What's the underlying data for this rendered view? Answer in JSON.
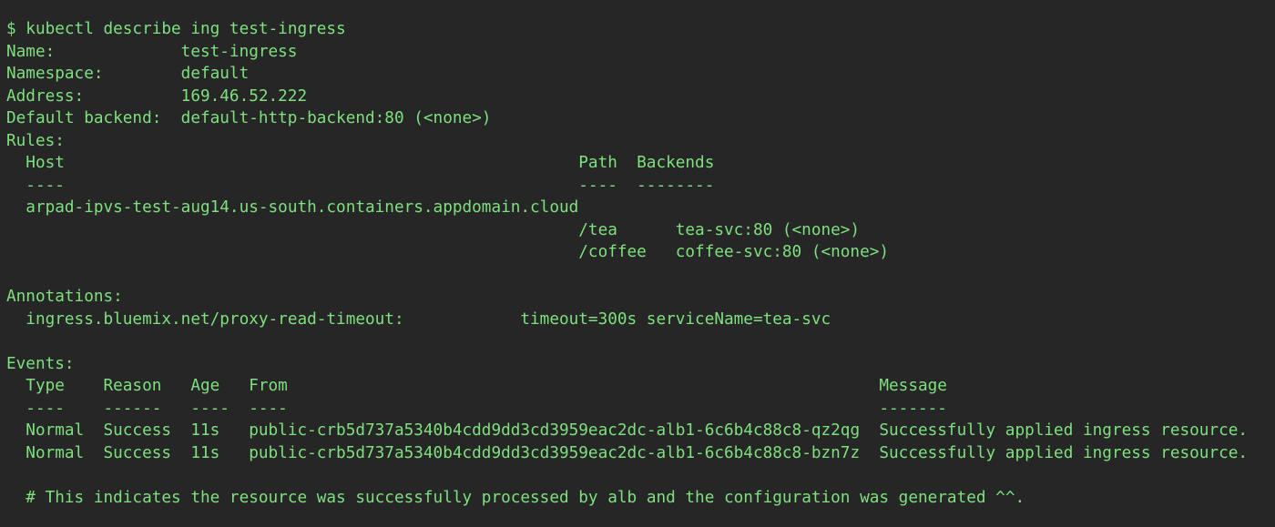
{
  "command": "$ kubectl describe ing test-ingress",
  "fields": {
    "name_label": "Name:",
    "name": "test-ingress",
    "namespace_label": "Namespace:",
    "namespace": "default",
    "address_label": "Address:",
    "address": "169.46.52.222",
    "backend_label": "Default backend:",
    "backend": "default-http-backend:80 (<none>)"
  },
  "rules": {
    "label": "Rules:",
    "headers": {
      "host": "Host",
      "path": "Path",
      "backends": "Backends"
    },
    "dashes": {
      "host": "----",
      "path": "----",
      "backends": "--------"
    },
    "host": "arpad-ipvs-test-aug14.us-south.containers.appdomain.cloud",
    "paths": [
      {
        "path": "/tea",
        "backend": "tea-svc:80 (<none>)"
      },
      {
        "path": "/coffee",
        "backend": "coffee-svc:80 (<none>)"
      }
    ]
  },
  "annotations": {
    "label": "Annotations:",
    "key": "ingress.bluemix.net/proxy-read-timeout:",
    "value": "timeout=300s serviceName=tea-svc"
  },
  "events": {
    "label": "Events:",
    "headers": {
      "type": "Type",
      "reason": "Reason",
      "age": "Age",
      "from": "From",
      "message": "Message"
    },
    "dashes": {
      "type": "----",
      "reason": "------",
      "age": "----",
      "from": "----",
      "message": "-------"
    },
    "rows": [
      {
        "type": "Normal",
        "reason": "Success",
        "age": "11s",
        "from": "public-crb5d737a5340b4cdd9dd3cd3959eac2dc-alb1-6c6b4c88c8-qz2qg",
        "message": "Successfully applied ingress resource."
      },
      {
        "type": "Normal",
        "reason": "Success",
        "age": "11s",
        "from": "public-crb5d737a5340b4cdd9dd3cd3959eac2dc-alb1-6c6b4c88c8-bzn7z",
        "message": "Successfully applied ingress resource."
      }
    ]
  },
  "comment": "# This indicates the resource was successfully processed by alb and the configuration was generated ^^.",
  "colors": {
    "background": "#262626",
    "text": "#7ee07e"
  }
}
